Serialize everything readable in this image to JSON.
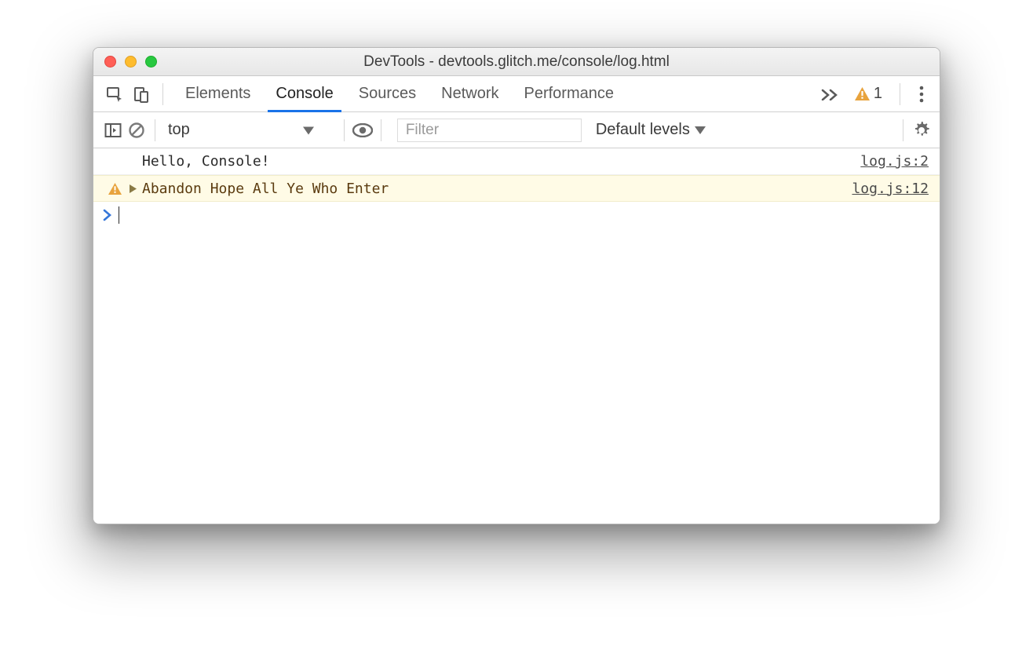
{
  "window": {
    "title": "DevTools - devtools.glitch.me/console/log.html"
  },
  "tabs": {
    "items": [
      "Elements",
      "Console",
      "Sources",
      "Network",
      "Performance"
    ],
    "active": "Console"
  },
  "warnings": {
    "count": "1"
  },
  "toolbar": {
    "context": "top",
    "filter_placeholder": "Filter",
    "levels_label": "Default levels"
  },
  "console": {
    "rows": [
      {
        "kind": "info",
        "text": "Hello, Console!",
        "source": "log.js:2"
      },
      {
        "kind": "warn",
        "text": "Abandon Hope All Ye Who Enter",
        "source": "log.js:12"
      }
    ]
  }
}
